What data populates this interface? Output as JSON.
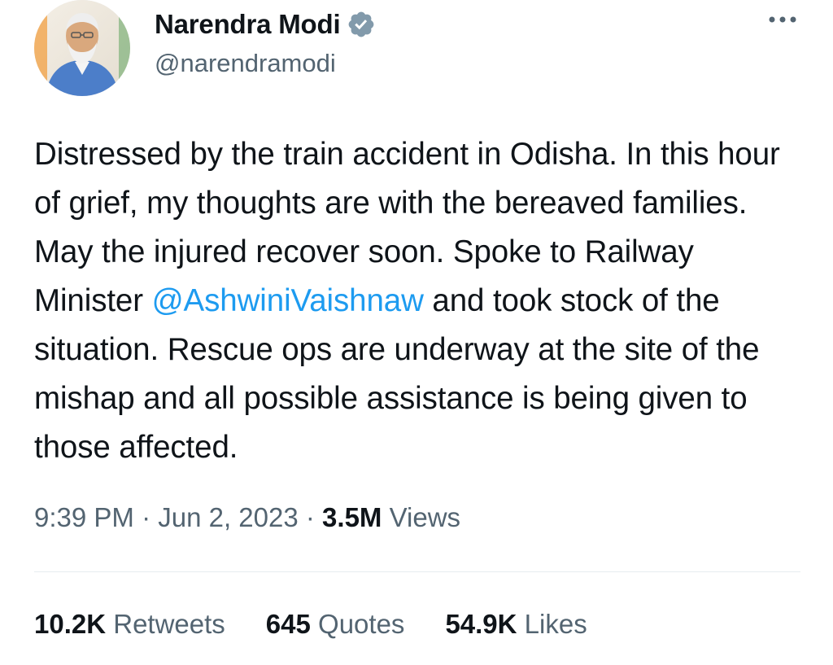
{
  "author": {
    "display_name": "Narendra Modi",
    "handle": "@narendramodi",
    "verified_icon": "verified-badge-icon",
    "avatar_icon": "profile-avatar"
  },
  "more_icon": "more-options-icon",
  "tweet": {
    "text_before_mention": "Distressed by the train accident in Odisha. In this hour of grief, my thoughts are with the bereaved families. May the injured recover soon. Spoke to Railway Minister ",
    "mention": "@AshwiniVaishnaw",
    "text_after_mention": " and took stock of the situation. Rescue ops are underway at the site of the mishap and all possible assistance is being given to those affected."
  },
  "meta": {
    "time": "9:39 PM",
    "separator": " · ",
    "date": "Jun 2, 2023",
    "separator2": " · ",
    "views_count": "3.5M",
    "views_label": " Views"
  },
  "stats": {
    "retweets_count": "10.2K",
    "retweets_label": " Retweets",
    "quotes_count": "645",
    "quotes_label": " Quotes",
    "likes_count": "54.9K",
    "likes_label": " Likes"
  },
  "colors": {
    "accent": "#1d9bf0",
    "secondary_text": "#536471",
    "primary_text": "#0f1419",
    "verified_badge": "#829aab"
  }
}
